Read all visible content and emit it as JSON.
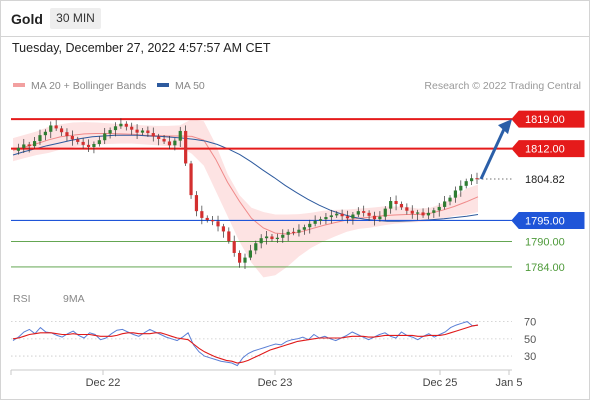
{
  "header": {
    "instrument": "Gold",
    "timeframe": "30 MIN",
    "datetime": "Tuesday, December 27, 2022 4:57:57 AM CET"
  },
  "legend": {
    "bollinger_label": "MA 20 + Bollinger Bands",
    "ma50_label": "MA 50",
    "research_credit": "Research © 2022 Trading Central"
  },
  "rsi_legend": {
    "rsi_label": "RSI",
    "ma_label": "9MA"
  },
  "colors": {
    "bollinger": "#f08a8a",
    "band_fill": "#fde3e3",
    "ma50": "#2d5a9e",
    "resistance": "#e51b1b",
    "current": "#444444",
    "pivot": "#1f55d8",
    "support": "#4e9a3a",
    "arrow": "#2b5fa8",
    "candle_up": "#2e7d32",
    "candle_down": "#d32f2f",
    "rsi": "#5a7fd6",
    "rsi_ma": "#e01a1a"
  },
  "chart_data": {
    "type": "candlestick",
    "title": "Gold",
    "timeframe": "30 MIN",
    "x_tick_labels": [
      "Dec 22",
      "Dec 23",
      "Dec 25",
      "Jan 5"
    ],
    "y_range": [
      1779,
      1824
    ],
    "levels": [
      {
        "label": "1819.00",
        "value": 1819.0,
        "kind": "resistance"
      },
      {
        "label": "1812.00",
        "value": 1812.0,
        "kind": "resistance"
      },
      {
        "label": "1804.82",
        "value": 1804.82,
        "kind": "current"
      },
      {
        "label": "1795.00",
        "value": 1795.0,
        "kind": "pivot"
      },
      {
        "label": "1790.00",
        "value": 1790.0,
        "kind": "support"
      },
      {
        "label": "1784.00",
        "value": 1784.0,
        "kind": "support"
      }
    ],
    "forecast_target": 1819.0,
    "price_series": [
      1811.5,
      1812.2,
      1813.0,
      1812.6,
      1813.8,
      1815.2,
      1816.0,
      1817.5,
      1816.8,
      1815.9,
      1815.0,
      1814.2,
      1813.6,
      1812.9,
      1812.4,
      1813.1,
      1814.0,
      1815.6,
      1816.4,
      1817.3,
      1817.9,
      1817.2,
      1816.5,
      1815.8,
      1816.3,
      1815.7,
      1814.9,
      1814.3,
      1813.7,
      1812.8,
      1813.9,
      1816.2,
      1808.5,
      1801.0,
      1797.2,
      1795.6,
      1795.1,
      1794.8,
      1793.6,
      1792.4,
      1790.1,
      1787.3,
      1785.0,
      1786.2,
      1787.9,
      1789.6,
      1790.8,
      1791.2,
      1790.6,
      1790.9,
      1791.6,
      1792.3,
      1792.1,
      1792.8,
      1793.4,
      1794.2,
      1794.9,
      1795.3,
      1795.8,
      1796.2,
      1796.6,
      1796.0,
      1795.5,
      1796.4,
      1797.2,
      1796.8,
      1796.1,
      1795.3,
      1795.9,
      1797.8,
      1799.6,
      1798.9,
      1798.1,
      1797.3,
      1796.6,
      1796.9,
      1796.2,
      1796.8,
      1797.4,
      1798.2,
      1799.5,
      1800.4,
      1802.1,
      1803.2,
      1804.3,
      1805.0,
      1804.82
    ],
    "ma50_series": [
      1810.5,
      1811.3,
      1812.0,
      1812.7,
      1813.3,
      1813.9,
      1814.4,
      1814.8,
      1815.0,
      1815.2,
      1815.2,
      1815.2,
      1815.0,
      1814.9,
      1814.7,
      1814.5,
      1814.2,
      1813.8,
      1813.0,
      1811.9,
      1810.6,
      1808.9,
      1807.0,
      1805.2,
      1803.3,
      1801.6,
      1800.0,
      1798.6,
      1797.4,
      1796.5,
      1795.8,
      1795.3,
      1795.0,
      1794.8,
      1794.8,
      1794.9,
      1795.0,
      1795.2,
      1795.4,
      1795.7,
      1796.0,
      1796.4
    ],
    "bollinger": {
      "upper": [
        1814.5,
        1815.3,
        1816.1,
        1817.2,
        1817.8,
        1818.2,
        1818.3,
        1818.2,
        1818.0,
        1817.8,
        1817.7,
        1817.5,
        1817.4,
        1817.4,
        1817.5,
        1819.0,
        1818.5,
        1813.0,
        1806.0,
        1801.0,
        1798.0,
        1797.0,
        1796.4,
        1796.4,
        1796.5,
        1796.8,
        1797.3,
        1797.5,
        1797.6,
        1797.8,
        1798.0,
        1798.3,
        1798.3,
        1798.2,
        1797.8,
        1798.0,
        1799.0,
        1800.5,
        1802.5,
        1803.5
      ],
      "mid": [
        1811.6,
        1812.4,
        1813.2,
        1814.1,
        1814.8,
        1815.2,
        1815.5,
        1815.6,
        1815.6,
        1815.5,
        1815.4,
        1815.2,
        1815.1,
        1815.0,
        1815.0,
        1814.9,
        1814.0,
        1809.5,
        1804.0,
        1799.5,
        1795.5,
        1793.2,
        1792.0,
        1791.8,
        1792.2,
        1793.0,
        1793.8,
        1794.5,
        1795.1,
        1795.5,
        1795.8,
        1796.1,
        1796.3,
        1796.4,
        1796.4,
        1796.7,
        1797.4,
        1798.3,
        1799.4,
        1800.6
      ],
      "lower": [
        1809.0,
        1809.8,
        1810.5,
        1811.0,
        1811.8,
        1812.3,
        1812.7,
        1812.9,
        1813.1,
        1813.2,
        1813.2,
        1813.0,
        1812.8,
        1812.6,
        1812.5,
        1810.8,
        1808.0,
        1802.0,
        1796.0,
        1790.0,
        1785.0,
        1781.5,
        1782.0,
        1784.0,
        1786.5,
        1788.5,
        1790.0,
        1791.2,
        1792.3,
        1793.0,
        1793.3,
        1793.8,
        1794.2,
        1794.5,
        1794.6,
        1794.8,
        1795.3,
        1796.1,
        1796.3,
        1797.0
      ]
    },
    "rsi": {
      "y_tick_labels": [
        "70",
        "50",
        "30"
      ],
      "y_range": [
        15,
        80
      ],
      "rsi_series": [
        48,
        52,
        58,
        61,
        56,
        63,
        58,
        57,
        54,
        52,
        56,
        59,
        54,
        51,
        57,
        55,
        49,
        51,
        56,
        60,
        61,
        58,
        55,
        53,
        57,
        61,
        58,
        55,
        52,
        50,
        48,
        52,
        57,
        43,
        35,
        30,
        28,
        26,
        24,
        23,
        22,
        19,
        28,
        33,
        36,
        38,
        40,
        42,
        44,
        43,
        47,
        49,
        50,
        52,
        49,
        55,
        51,
        53,
        50,
        48,
        51,
        54,
        58,
        55,
        52,
        49,
        52,
        55,
        57,
        53,
        51,
        58,
        54,
        52,
        49,
        53,
        56,
        52,
        55,
        58,
        63,
        66,
        68,
        70,
        65,
        66
      ],
      "ma_series": [
        50,
        51,
        53,
        55,
        56,
        57,
        57,
        57,
        56,
        55,
        55,
        56,
        55,
        55,
        55,
        54,
        53,
        53,
        53,
        54,
        56,
        57,
        57,
        56,
        56,
        56,
        57,
        57,
        55,
        53,
        51,
        50,
        49,
        44,
        39,
        35,
        32,
        29,
        27,
        25,
        24,
        22,
        23,
        25,
        28,
        31,
        34,
        37,
        39,
        41,
        43,
        45,
        47,
        48,
        49,
        50,
        51,
        51,
        51,
        51,
        51,
        52,
        53,
        53,
        53,
        52,
        52,
        53,
        54,
        54,
        54,
        54,
        54,
        54,
        53,
        53,
        54,
        54,
        54,
        55,
        57,
        59,
        61,
        63,
        65,
        66
      ]
    }
  }
}
